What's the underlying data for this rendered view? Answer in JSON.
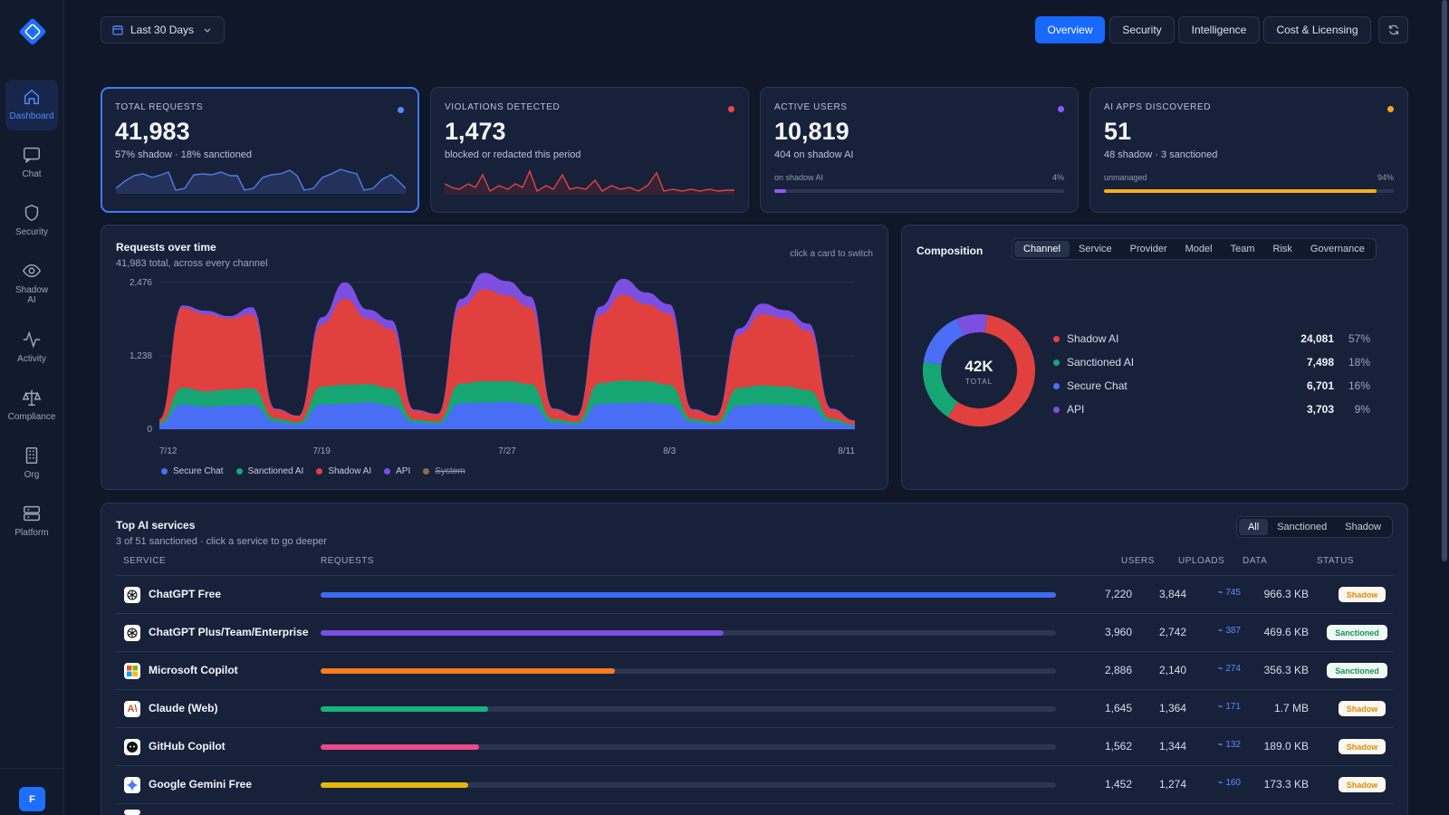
{
  "sidebar": {
    "items": [
      {
        "label": "Dashboard",
        "icon": "home-icon"
      },
      {
        "label": "Chat",
        "icon": "chat-icon"
      },
      {
        "label": "Security",
        "icon": "shield-icon"
      },
      {
        "label": "Shadow AI",
        "icon": "eye-icon"
      },
      {
        "label": "Activity",
        "icon": "activity-icon"
      },
      {
        "label": "Compliance",
        "icon": "scale-icon"
      },
      {
        "label": "Org",
        "icon": "building-icon"
      },
      {
        "label": "Platform",
        "icon": "server-icon"
      }
    ],
    "avatar": "F"
  },
  "toolbar": {
    "date_range": "Last 30 Days",
    "tabs": [
      "Overview",
      "Security",
      "Intelligence",
      "Cost & Licensing"
    ],
    "active_tab": "Overview"
  },
  "kpis": [
    {
      "label": "TOTAL REQUESTS",
      "value": "41,983",
      "sub": "57% shadow · 18% sanctioned",
      "dot": "#4f8bff"
    },
    {
      "label": "VIOLATIONS DETECTED",
      "value": "1,473",
      "sub": "blocked or redacted this period",
      "dot": "#f04646"
    },
    {
      "label": "ACTIVE USERS",
      "value": "10,819",
      "sub": "404 on shadow AI",
      "dot": "#8b5cf6",
      "bar_label": "on shadow AI",
      "bar_pct": "4%",
      "bar_fraction": 0.04
    },
    {
      "label": "AI APPS DISCOVERED",
      "value": "51",
      "sub": "48 shadow · 3 sanctioned",
      "dot": "#f5a623",
      "bar_label": "unmanaged",
      "bar_pct": "94%",
      "bar_fraction": 0.94
    }
  ],
  "requests_panel": {
    "title": "Requests over time",
    "subtitle": "41,983 total, across every channel",
    "hint": "click a card to switch"
  },
  "chart_data": {
    "type": "area",
    "stacked": true,
    "ylim": [
      0,
      2476
    ],
    "yticks": [
      "2,476",
      "1,238",
      "0"
    ],
    "xticks": [
      "7/12",
      "7/19",
      "7/27",
      "8/3",
      "8/11"
    ],
    "x": [
      "7/12",
      "7/13",
      "7/14",
      "7/15",
      "7/16",
      "7/17",
      "7/18",
      "7/19",
      "7/20",
      "7/21",
      "7/22",
      "7/23",
      "7/24",
      "7/25",
      "7/26",
      "7/27",
      "7/28",
      "7/29",
      "7/30",
      "7/31",
      "8/1",
      "8/2",
      "8/3",
      "8/4",
      "8/5",
      "8/6",
      "8/7",
      "8/8",
      "8/9",
      "8/10",
      "8/11"
    ],
    "series": [
      {
        "name": "Secure Chat",
        "color": "#4a6ef5",
        "values": [
          80,
          420,
          380,
          400,
          410,
          120,
          80,
          420,
          430,
          450,
          400,
          110,
          90,
          440,
          450,
          460,
          420,
          110,
          80,
          430,
          440,
          450,
          420,
          120,
          80,
          400,
          420,
          410,
          380,
          120,
          60
        ]
      },
      {
        "name": "Sanctioned AI",
        "color": "#16a673",
        "values": [
          30,
          280,
          260,
          270,
          280,
          60,
          40,
          300,
          320,
          310,
          290,
          50,
          40,
          330,
          360,
          350,
          340,
          60,
          40,
          350,
          380,
          360,
          330,
          50,
          40,
          300,
          320,
          310,
          280,
          60,
          20
        ]
      },
      {
        "name": "Shadow AI",
        "color": "#e0413f",
        "values": [
          50,
          1350,
          1300,
          1200,
          1250,
          150,
          100,
          1050,
          1450,
          1100,
          1000,
          150,
          120,
          1300,
          1550,
          1450,
          1300,
          160,
          100,
          1150,
          1450,
          1300,
          1200,
          150,
          100,
          900,
          1200,
          1150,
          1000,
          150,
          60
        ]
      },
      {
        "name": "API",
        "color": "#7c4fe0",
        "values": [
          10,
          40,
          60,
          40,
          120,
          20,
          10,
          120,
          280,
          160,
          150,
          20,
          10,
          130,
          280,
          240,
          180,
          20,
          10,
          140,
          270,
          200,
          160,
          20,
          10,
          100,
          180,
          140,
          120,
          20,
          10
        ]
      },
      {
        "name": "System",
        "color": "#8a6d4d",
        "values": [
          0,
          0,
          0,
          0,
          0,
          0,
          0,
          0,
          0,
          0,
          0,
          0,
          0,
          0,
          0,
          0,
          0,
          0,
          0,
          0,
          0,
          0,
          0,
          0,
          0,
          0,
          0,
          0,
          0,
          0,
          0
        ],
        "hidden": true
      }
    ]
  },
  "composition": {
    "title": "Composition",
    "tabs": [
      "Channel",
      "Service",
      "Provider",
      "Model",
      "Team",
      "Risk",
      "Governance"
    ],
    "active_tab": "Channel",
    "center_value": "42K",
    "center_label": "TOTAL",
    "rows": [
      {
        "name": "Shadow AI",
        "value": "24,081",
        "pct": "57%",
        "color": "#e0413f",
        "fraction": 0.57
      },
      {
        "name": "Sanctioned AI",
        "value": "7,498",
        "pct": "18%",
        "color": "#16a673",
        "fraction": 0.18
      },
      {
        "name": "Secure Chat",
        "value": "6,701",
        "pct": "16%",
        "color": "#4a6ef5",
        "fraction": 0.16
      },
      {
        "name": "API",
        "value": "3,703",
        "pct": "9%",
        "color": "#7c4fe0",
        "fraction": 0.09
      }
    ]
  },
  "services": {
    "title": "Top AI services",
    "subtitle": "3 of 51 sanctioned · click a service to go deeper",
    "filters": [
      "All",
      "Sanctioned",
      "Shadow"
    ],
    "active_filter": "All",
    "columns": [
      "SERVICE",
      "REQUESTS",
      "USERS",
      "UPLOADS",
      "DATA",
      "STATUS"
    ],
    "rows": [
      {
        "name": "ChatGPT Free",
        "requests": "7,220",
        "users": "3,844",
        "uploads": "745",
        "data": "966.3 KB",
        "status": "Shadow",
        "bar_color": "#3d6bf0",
        "fraction": 1.0,
        "icon": "openai-icon"
      },
      {
        "name": "ChatGPT Plus/Team/Enterprise",
        "requests": "3,960",
        "users": "2,742",
        "uploads": "387",
        "data": "469.6 KB",
        "status": "Sanctioned",
        "bar_color": "#7c4fe0",
        "fraction": 0.548,
        "icon": "openai-icon"
      },
      {
        "name": "Microsoft Copilot",
        "requests": "2,886",
        "users": "2,140",
        "uploads": "274",
        "data": "356.3 KB",
        "status": "Sanctioned",
        "bar_color": "#f57c1f",
        "fraction": 0.4,
        "icon": "microsoft-icon"
      },
      {
        "name": "Claude (Web)",
        "requests": "1,645",
        "users": "1,364",
        "uploads": "171",
        "data": "1.7 MB",
        "status": "Shadow",
        "bar_color": "#16b37a",
        "fraction": 0.228,
        "icon": "anthropic-icon"
      },
      {
        "name": "GitHub Copilot",
        "requests": "1,562",
        "users": "1,344",
        "uploads": "132",
        "data": "189.0 KB",
        "status": "Shadow",
        "bar_color": "#e84a8a",
        "fraction": 0.216,
        "icon": "github-icon"
      },
      {
        "name": "Google Gemini Free",
        "requests": "1,452",
        "users": "1,274",
        "uploads": "160",
        "data": "173.3 KB",
        "status": "Shadow",
        "bar_color": "#e6b80f",
        "fraction": 0.201,
        "icon": "gemini-icon"
      }
    ]
  }
}
